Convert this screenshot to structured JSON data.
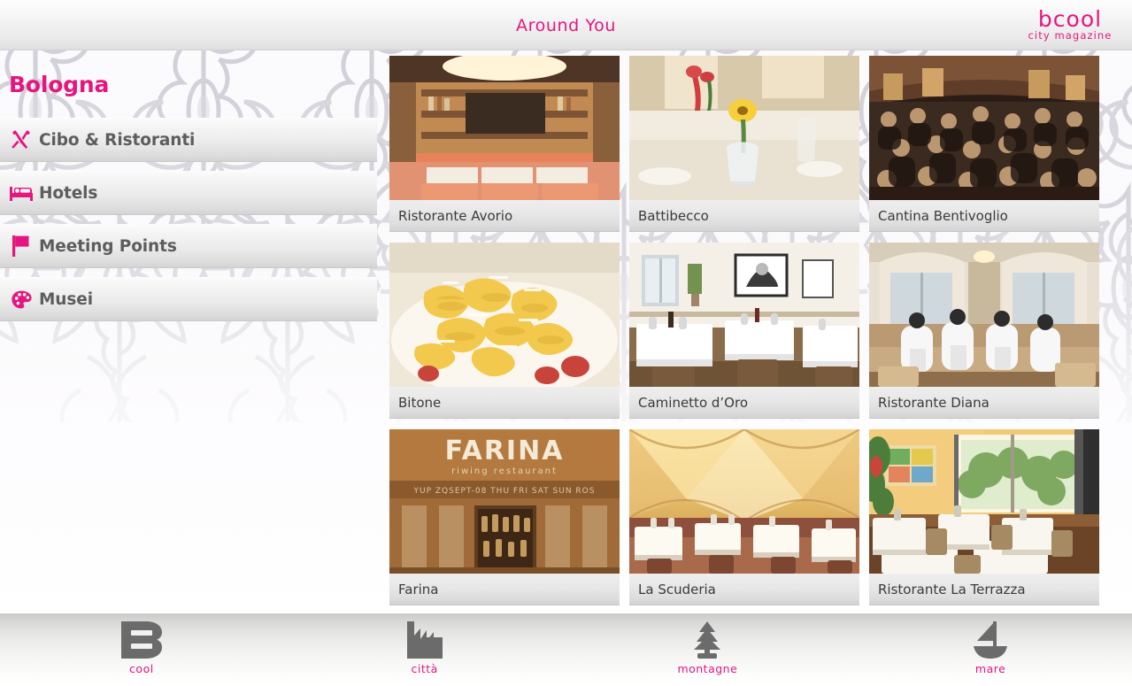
{
  "header": {
    "title": "Around You",
    "logo_main": "bcool",
    "logo_sub": "city magazine"
  },
  "sidebar": {
    "city": "Bologna",
    "items": [
      {
        "label": "Cibo & Ristoranti",
        "icon": "fork-knife-icon"
      },
      {
        "label": "Hotels",
        "icon": "bed-icon"
      },
      {
        "label": "Meeting Points",
        "icon": "flag-icon"
      },
      {
        "label": "Musei",
        "icon": "palette-icon"
      }
    ]
  },
  "main": {
    "cards": [
      {
        "title": "Ristorante Avorio",
        "image": "restaurant-interior-orange-booths"
      },
      {
        "title": "Battibecco",
        "image": "table-setting-yellow-flowers"
      },
      {
        "title": "Cantina Bentivoglio",
        "image": "crowded-wine-cellar-restaurant"
      },
      {
        "title": "Bitone",
        "image": "pasta-tortellini-plate"
      },
      {
        "title": "Caminetto d’Oro",
        "image": "white-tablecloth-dining-room"
      },
      {
        "title": "Ristorante Diana",
        "image": "waiters-in-dining-hall"
      },
      {
        "title": "Farina",
        "image": "farina-restaurant-sign"
      },
      {
        "title": "La Scuderia",
        "image": "vaulted-ceiling-hall"
      },
      {
        "title": "Ristorante La Terrazza",
        "image": "bright-terrace-restaurant"
      }
    ]
  },
  "footer": {
    "items": [
      {
        "label": "cool",
        "icon": "bcool-b-icon"
      },
      {
        "label": "città",
        "icon": "city-skyline-icon"
      },
      {
        "label": "montagne",
        "icon": "pine-tree-icon"
      },
      {
        "label": "mare",
        "icon": "sailboat-icon"
      }
    ]
  },
  "colors": {
    "accent": "#e5167f",
    "text_dark": "#3a3a3a",
    "menu_text": "#5d5d5d",
    "footer_icon": "#6b6b6b"
  }
}
